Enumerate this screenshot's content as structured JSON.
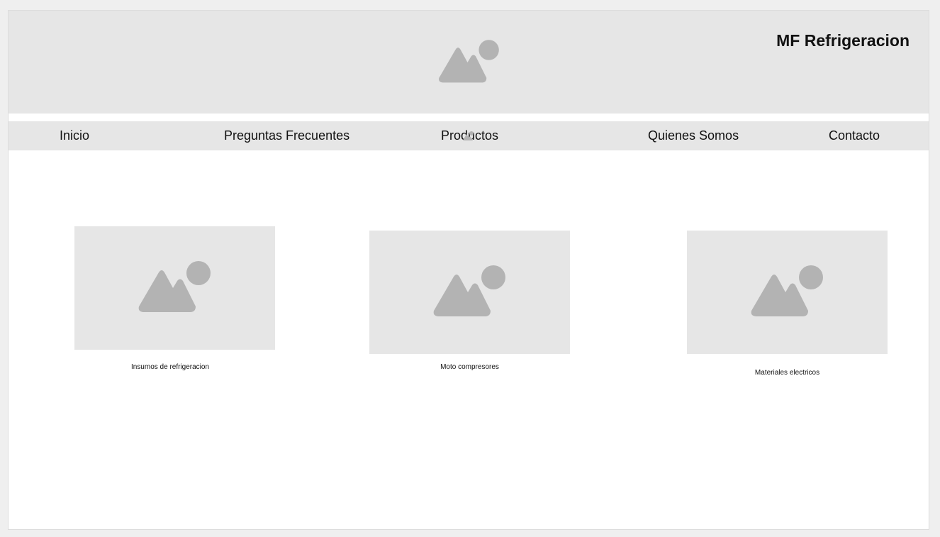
{
  "header": {
    "brand": "MF Refrigeracion",
    "banner_icon": "image-placeholder-icon"
  },
  "nav": {
    "items": [
      {
        "label": "Inicio"
      },
      {
        "label": "Preguntas Frecuentes"
      },
      {
        "label": "Productos"
      },
      {
        "label": "Quienes Somos"
      },
      {
        "label": "Contacto"
      }
    ]
  },
  "products": [
    {
      "caption": "Insumos de refrigeracion",
      "icon": "image-placeholder-icon"
    },
    {
      "caption": "Moto compresores",
      "icon": "image-placeholder-icon"
    },
    {
      "caption": "Materiales electricos",
      "icon": "image-placeholder-icon"
    }
  ],
  "colors": {
    "background": "#efefef",
    "panel": "#e6e6e6",
    "placeholder_glyph": "#b3b3b3",
    "text": "#111111"
  }
}
